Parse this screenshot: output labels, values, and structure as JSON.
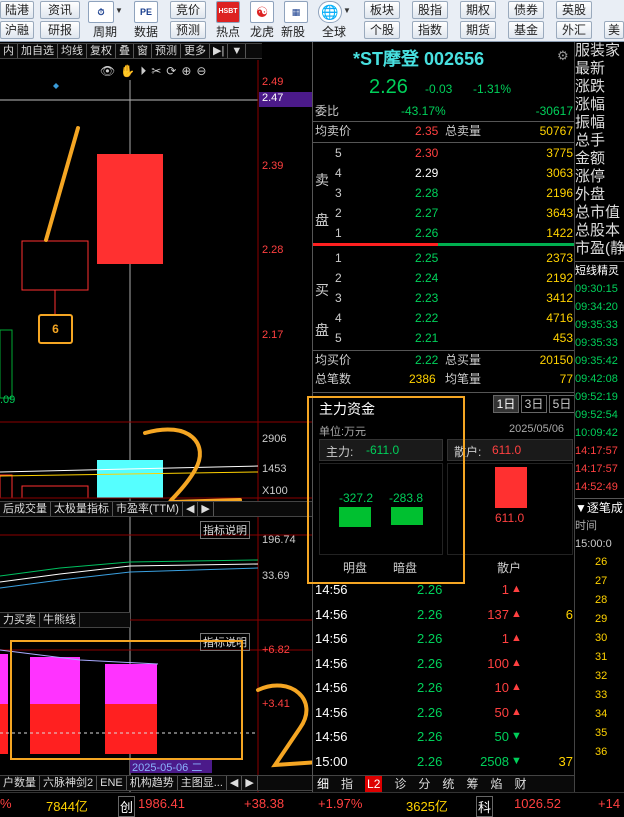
{
  "toolbar": {
    "col1": [
      "陆港",
      "沪融"
    ],
    "col2": [
      "资讯",
      "研报"
    ],
    "period": "周期",
    "data": "数据",
    "jingjia": "竞价",
    "yuce": "预测",
    "hot": "热点",
    "longhu": "龙虎",
    "xingu": "新股",
    "quanqiu": "全球",
    "right_top": [
      "板块",
      "股指",
      "期权",
      "债券",
      "英股"
    ],
    "right_bottom": [
      "个股",
      "指数",
      "期货",
      "基金",
      "外汇",
      "美"
    ]
  },
  "chart": {
    "tabs_top": [
      "内",
      "加自选",
      "均线",
      "复权",
      "叠",
      "窗",
      "预测",
      "更多"
    ],
    "price_axis": [
      "2.49",
      "2.47",
      "2.39",
      "2.28",
      "2.17"
    ],
    "low_label": ".09",
    "vol_axis": [
      "2906",
      "1453",
      "X100"
    ],
    "ind_tabs": [
      "后成交量",
      "太极量指标",
      "市盈率(TTM)"
    ],
    "ind_btn": "指标说明",
    "ind2_axis": [
      "196.74",
      "33.69"
    ],
    "ind3_tabs": [
      "力买卖",
      "牛熊线"
    ],
    "ind3_btn": "指标说明",
    "ind3_axis": [
      "+6.82",
      "+3.41"
    ],
    "date_label": "2025-05-06 二",
    "bottom_tabs": [
      "户数量",
      "六脉神剑2",
      "ENE",
      "机构趋势",
      "主图显..."
    ]
  },
  "quote": {
    "name": "*ST摩登",
    "code": "002656",
    "price": "2.26",
    "change": "-0.03",
    "pct": "-1.31%",
    "weibi_label": "委比",
    "weibi": "-43.17%",
    "weicha": "-30617",
    "avg_sell_label": "均卖价",
    "avg_sell": "2.35",
    "total_sell_label": "总卖量",
    "total_sell": "50767",
    "sell_side": "卖盘",
    "buy_side": "买盘",
    "sells": [
      {
        "lvl": "5",
        "price": "2.30",
        "vol": "3775",
        "color": "red"
      },
      {
        "lvl": "4",
        "price": "2.29",
        "vol": "3063",
        "color": "white"
      },
      {
        "lvl": "3",
        "price": "2.28",
        "vol": "2196",
        "color": "green"
      },
      {
        "lvl": "2",
        "price": "2.27",
        "vol": "3643",
        "color": "green"
      },
      {
        "lvl": "1",
        "price": "2.26",
        "vol": "1422",
        "color": "green"
      }
    ],
    "buys": [
      {
        "lvl": "1",
        "price": "2.25",
        "vol": "2373"
      },
      {
        "lvl": "2",
        "price": "2.24",
        "vol": "2192"
      },
      {
        "lvl": "3",
        "price": "2.23",
        "vol": "3412"
      },
      {
        "lvl": "4",
        "price": "2.22",
        "vol": "4716"
      },
      {
        "lvl": "5",
        "price": "2.21",
        "vol": "453"
      }
    ],
    "avg_buy_label": "均买价",
    "avg_buy": "2.22",
    "total_buy_label": "总买量",
    "total_buy": "20150",
    "total_trades_label": "总笔数",
    "total_trades": "2386",
    "avg_trade_label": "均笔量",
    "avg_trade": "77"
  },
  "capital": {
    "title": "主力资金",
    "unit": "单位:万元",
    "tabs": [
      "1日",
      "3日",
      "5日"
    ],
    "date": "2025/05/06",
    "main_label": "主力:",
    "main_value": "-611.0",
    "retail_label": "散户:",
    "retail_value": "611.0",
    "ming_value": "-327.2",
    "an_value": "-283.8",
    "retail_bar_value": "611.0",
    "ming_label": "明盘",
    "an_label": "暗盘",
    "retail_bottom": "散户"
  },
  "ticks": [
    {
      "time": "14:56",
      "price": "2.26",
      "vol": "1",
      "dir": "up",
      "side": ""
    },
    {
      "time": "14:56",
      "price": "2.26",
      "vol": "137",
      "dir": "up",
      "side": "6"
    },
    {
      "time": "14:56",
      "price": "2.26",
      "vol": "1",
      "dir": "up",
      "side": ""
    },
    {
      "time": "14:56",
      "price": "2.26",
      "vol": "100",
      "dir": "up",
      "side": ""
    },
    {
      "time": "14:56",
      "price": "2.26",
      "vol": "10",
      "dir": "up",
      "side": ""
    },
    {
      "time": "14:56",
      "price": "2.26",
      "vol": "50",
      "dir": "up",
      "side": ""
    },
    {
      "time": "14:56",
      "price": "2.26",
      "vol": "50",
      "dir": "down",
      "side": ""
    },
    {
      "time": "15:00",
      "price": "2.26",
      "vol": "2508",
      "dir": "down",
      "side": "37"
    }
  ],
  "tick_tabs": [
    "细",
    "指",
    "L2",
    "诊",
    "分",
    "统",
    "筹",
    "焰",
    "财"
  ],
  "sidebar": {
    "labels": [
      "服装家",
      "最新",
      "涨跌",
      "涨幅",
      "振幅",
      "总手",
      "金额",
      "涨停",
      "外盘",
      "总市值",
      "总股本",
      "市盈(静"
    ],
    "news_title": "短线精灵",
    "news_times": [
      "09:30:15",
      "09:34:20",
      "09:35:33",
      "09:35:33",
      "09:35:42",
      "09:42:08",
      "09:52:19",
      "09:52:54",
      "10:09:42",
      "14:17:57",
      "14:17:57",
      "14:52:49"
    ],
    "zhubi_title": "逐笔成",
    "time_label": "时间",
    "time_first": "15:00:0",
    "nums": [
      "26",
      "27",
      "28",
      "29",
      "30",
      "31",
      "32",
      "33",
      "34",
      "35",
      "36"
    ]
  },
  "bottom": {
    "pct_left": "%",
    "amt": "7844亿",
    "chuang_label": "创",
    "chuang": "1986.41",
    "chuang_chg": "+38.38",
    "chuang_pct": "+1.97%",
    "chuang_amt": "3625亿",
    "ke_label": "科",
    "ke": "1026.52",
    "ke_chg": "+14"
  },
  "annotations": {
    "one": "1",
    "two_a": "2",
    "two_b": "2",
    "badge": "6"
  }
}
